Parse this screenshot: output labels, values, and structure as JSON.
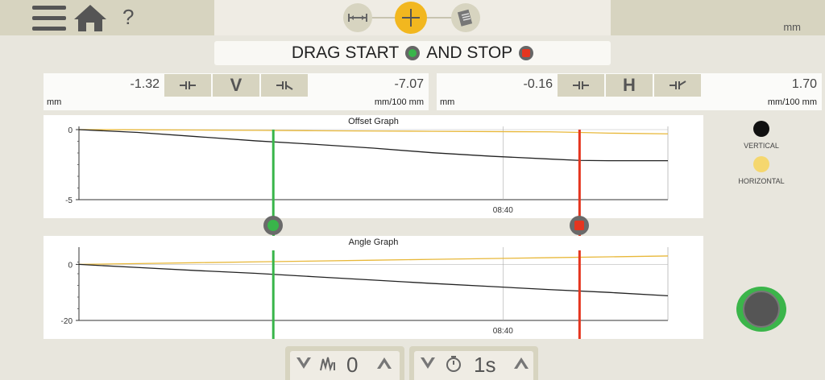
{
  "toolbar": {
    "menu_icon": "hamburger-menu-icon",
    "home_icon": "home-icon",
    "help_label": "?",
    "unit_label": "mm",
    "modes": [
      "horizontal-measure-icon",
      "crosshair-icon",
      "report-icon"
    ]
  },
  "instruction": {
    "text_before": "DRAG START",
    "text_middle": "AND STOP"
  },
  "vertical_panel": {
    "offset": "-1.32",
    "angle": "-7.07",
    "letter": "V",
    "offset_unit": "mm",
    "angle_unit": "mm/100 mm"
  },
  "horizontal_panel": {
    "offset": "-0.16",
    "angle": "1.70",
    "letter": "H",
    "offset_unit": "mm",
    "angle_unit": "mm/100 mm"
  },
  "legend": {
    "vertical_label": "VERTICAL",
    "horizontal_label": "HORIZONTAL",
    "vertical_color": "#111111",
    "horizontal_color": "#f5d76e"
  },
  "colors": {
    "start": "#39b54a",
    "stop": "#e5351f",
    "vertical_line": "#222222",
    "horizontal_line": "#e8b83a"
  },
  "chart_data": [
    {
      "type": "line",
      "title": "Offset Graph",
      "ylim": [
        -5,
        0
      ],
      "y_ticks": [
        "0",
        "-5"
      ],
      "x_tick_label": "08:40",
      "x": [
        0,
        0.1,
        0.2,
        0.3,
        0.4,
        0.5,
        0.6,
        0.7,
        0.8,
        0.85,
        0.9,
        1.0
      ],
      "series": [
        {
          "name": "VERTICAL",
          "values": [
            0,
            -0.2,
            -0.5,
            -0.8,
            -1.05,
            -1.32,
            -1.65,
            -1.9,
            -2.1,
            -2.2,
            -2.22,
            -2.22
          ]
        },
        {
          "name": "HORIZONTAL",
          "values": [
            0,
            -0.01,
            -0.03,
            -0.05,
            -0.08,
            -0.1,
            -0.12,
            -0.14,
            -0.16,
            -0.2,
            -0.25,
            -0.3
          ]
        }
      ],
      "start_fraction": 0.33,
      "stop_fraction": 0.85
    },
    {
      "type": "line",
      "title": "Angle Graph",
      "ylim": [
        -20,
        5
      ],
      "y_ticks": [
        "0",
        "-20"
      ],
      "x_tick_label": "08:40",
      "x": [
        0,
        0.1,
        0.2,
        0.3,
        0.4,
        0.5,
        0.6,
        0.7,
        0.8,
        0.9,
        1.0
      ],
      "series": [
        {
          "name": "VERTICAL",
          "values": [
            0,
            -1.1,
            -2.2,
            -3.2,
            -4.4,
            -5.6,
            -6.8,
            -7.9,
            -9.0,
            -10.0,
            -11.2
          ]
        },
        {
          "name": "HORIZONTAL",
          "values": [
            0,
            0.3,
            0.6,
            0.9,
            1.2,
            1.5,
            1.8,
            2.1,
            2.4,
            2.7,
            3.0
          ]
        }
      ],
      "start_fraction": 0.33,
      "stop_fraction": 0.85
    }
  ],
  "steppers": [
    {
      "icon": "filter-icon",
      "value": "0"
    },
    {
      "icon": "timer-icon",
      "value": "1s"
    }
  ]
}
